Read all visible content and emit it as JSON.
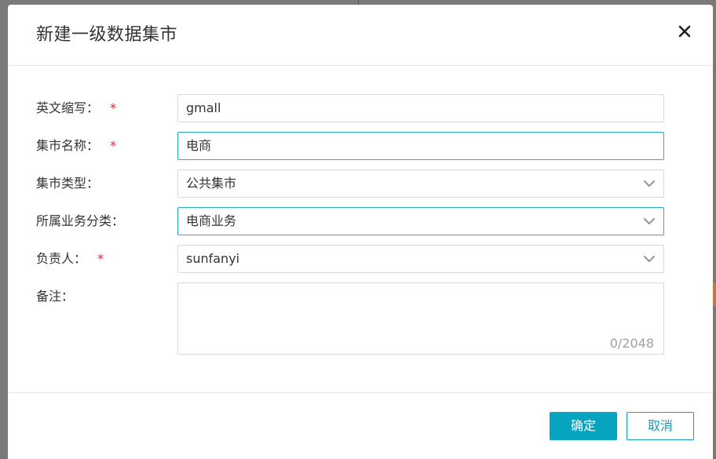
{
  "dialog": {
    "title": "新建一级数据集市",
    "close_icon": "close-icon"
  },
  "form": {
    "abbr": {
      "label": "英文缩写：",
      "required": "*",
      "value": "gmall"
    },
    "name": {
      "label": "集市名称：",
      "required": "*",
      "value": "电商"
    },
    "type": {
      "label": "集市类型：",
      "value": "公共集市"
    },
    "category": {
      "label": "所属业务分类：",
      "value": "电商业务"
    },
    "owner": {
      "label": "负责人：",
      "required": "*",
      "value": "sunfanyi"
    },
    "remark": {
      "label": "备注：",
      "count": "0/2048"
    }
  },
  "footer": {
    "confirm_label": "确定",
    "cancel_label": "取消"
  },
  "colors": {
    "accent": "#07a4bf",
    "focus_border": "#1fb4c9",
    "required": "#f5222d"
  }
}
